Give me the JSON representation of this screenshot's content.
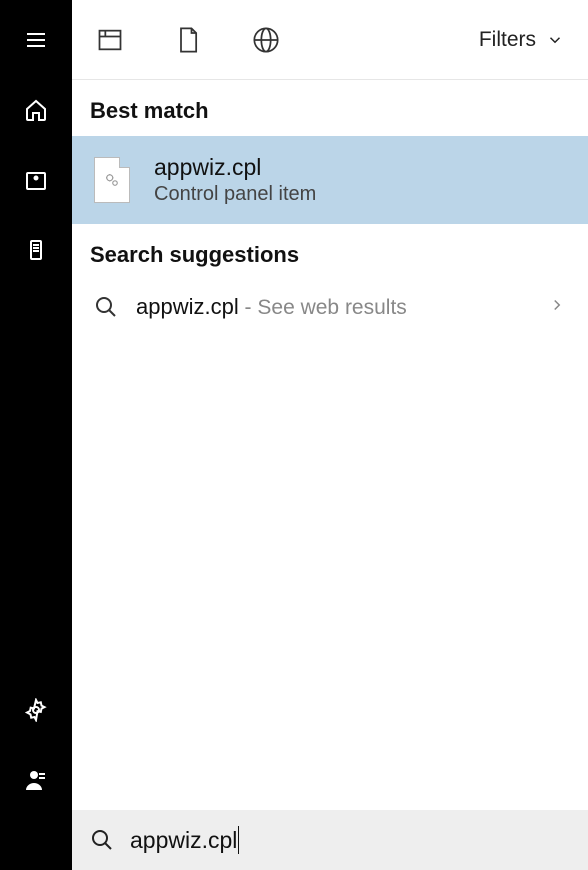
{
  "topbar": {
    "filters_label": "Filters"
  },
  "sections": {
    "best_match_header": "Best match",
    "suggestions_header": "Search suggestions"
  },
  "best_match": {
    "title": "appwiz.cpl",
    "subtitle": "Control panel item"
  },
  "suggestions": [
    {
      "primary": "appwiz.cpl",
      "secondary": " - See web results"
    }
  ],
  "search": {
    "query": "appwiz.cpl"
  }
}
